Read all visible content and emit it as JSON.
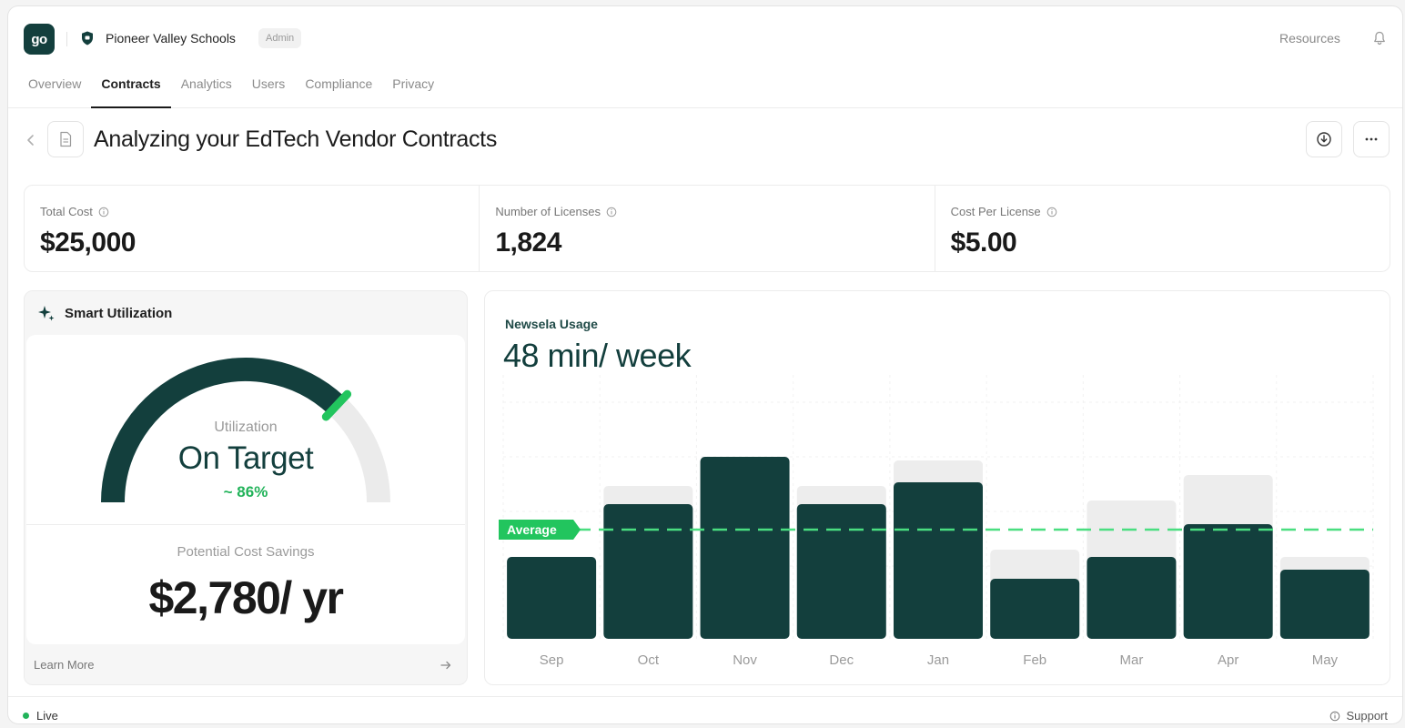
{
  "header": {
    "logo_text": "go",
    "org_name": "Pioneer Valley Schools",
    "role_badge": "Admin",
    "resources_label": "Resources"
  },
  "tabs": [
    {
      "label": "Overview",
      "active": false
    },
    {
      "label": "Contracts",
      "active": true
    },
    {
      "label": "Analytics",
      "active": false
    },
    {
      "label": "Users",
      "active": false
    },
    {
      "label": "Compliance",
      "active": false
    },
    {
      "label": "Privacy",
      "active": false
    }
  ],
  "page": {
    "title": "Analyzing your EdTech Vendor Contracts"
  },
  "stats": [
    {
      "label": "Total Cost",
      "value": "$25,000"
    },
    {
      "label": "Number of Licenses",
      "value": "1,824"
    },
    {
      "label": "Cost Per License",
      "value": "$5.00"
    }
  ],
  "utilization": {
    "heading": "Smart Utilization",
    "gauge_label": "Utilization",
    "status": "On Target",
    "percent_text": "~ 86%",
    "target_fraction": 0.74,
    "savings_label": "Potential Cost Savings",
    "savings_value": "$2,780/ yr",
    "learn_more": "Learn More"
  },
  "usage": {
    "label": "Newsela Usage",
    "value": "48 min/ week"
  },
  "chart_data": {
    "type": "bar",
    "categories": [
      "Sep",
      "Oct",
      "Nov",
      "Dec",
      "Jan",
      "Feb",
      "Mar",
      "Apr",
      "May"
    ],
    "series": [
      {
        "values": [
          45,
          74,
          100,
          74,
          86,
          33,
          45,
          63,
          38
        ]
      },
      {
        "values": [
          45,
          84,
          100,
          84,
          98,
          49,
          76,
          90,
          45
        ]
      }
    ],
    "average": 60,
    "average_label": "Average",
    "ylim": [
      0,
      100
    ],
    "grid": true
  },
  "colors": {
    "brand": "#133f3d",
    "accent_green": "#22c55e",
    "bar_background": "#ededed"
  },
  "footer": {
    "status": "Live",
    "support": "Support"
  }
}
